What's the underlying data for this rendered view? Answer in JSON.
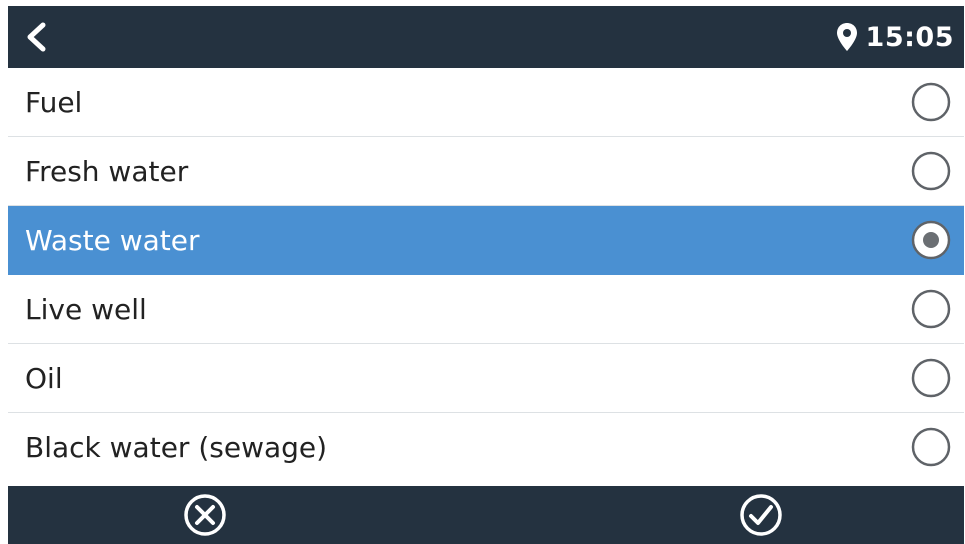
{
  "header": {
    "back_icon": "chevron-left-icon",
    "location_icon": "map-pin-icon",
    "time": "15:05"
  },
  "options": [
    {
      "label": "Fuel",
      "selected": false
    },
    {
      "label": "Fresh water",
      "selected": false
    },
    {
      "label": "Waste water",
      "selected": true
    },
    {
      "label": "Live well",
      "selected": false
    },
    {
      "label": "Oil",
      "selected": false
    },
    {
      "label": "Black water (sewage)",
      "selected": false
    }
  ],
  "footer": {
    "cancel_icon": "circle-x-icon",
    "confirm_icon": "circle-check-icon"
  },
  "colors": {
    "bar_background": "#243240",
    "selected_row": "#4a90d2",
    "text": "#222222",
    "radio_border": "#5f6368"
  }
}
